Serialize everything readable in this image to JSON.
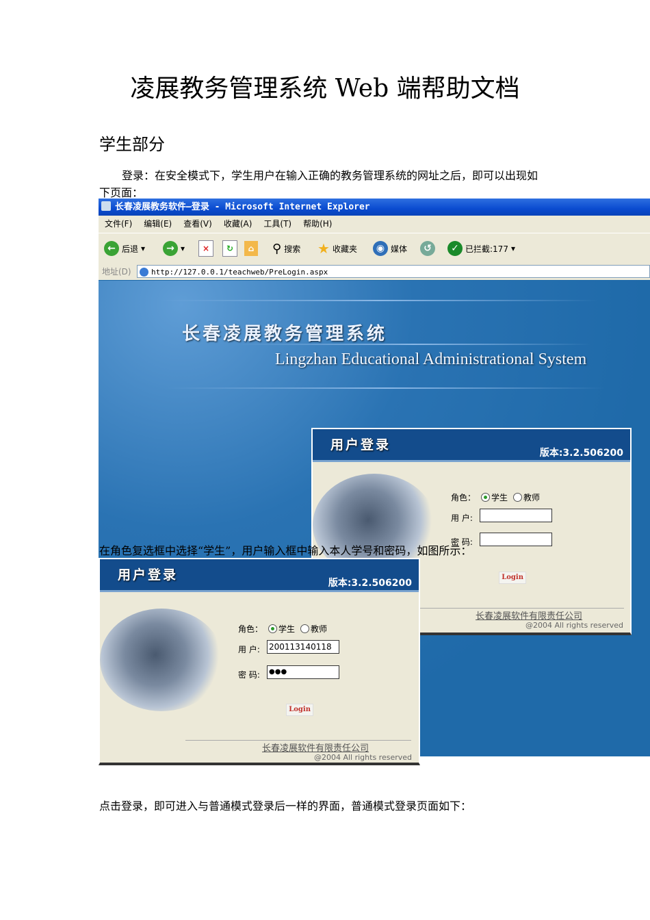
{
  "doc_title": "凌展教务管理系统 Web 端帮助文档",
  "section": "学生部分",
  "intro_line1": "登录：在安全模式下，学生用户在输入正确的教务管理系统的网址之后，即可以出现如",
  "intro_line2": "下页面：",
  "browser": {
    "title": "长春凌展教务软件—登录 - Microsoft Internet Explorer",
    "menu": [
      "文件(F)",
      "编辑(E)",
      "查看(V)",
      "收藏(A)",
      "工具(T)",
      "帮助(H)"
    ],
    "toolbar": {
      "back": "后退",
      "search": "搜索",
      "favorites": "收藏夹",
      "media": "媒体",
      "blocked": "已拦截:177"
    },
    "address_label": "地址(D)",
    "url": "http://127.0.0.1/teachweb/PreLogin.aspx"
  },
  "system": {
    "name_cn": "长春凌展教务管理系统",
    "name_en": "Lingzhan Educational Administrational System"
  },
  "login_panel": {
    "title": "用户登录",
    "version": "版本:3.2.506200",
    "role_label": "角色：",
    "role_student": "学生",
    "role_teacher": "教师",
    "user_label": "用 户:",
    "pass_label": "密 码:",
    "login_button": "Login",
    "company": "长春凌展软件有限责任公司",
    "copyright": "@2004 All rights reserved"
  },
  "filled_panel": {
    "user_value": "200113140118",
    "pass_value": "●●●"
  },
  "caption": "在角色复选框中选择“学生”，用户输入框中输入本人学号和密码，如图所示：",
  "bottom_text": "点击登录，即可进入与普通模式登录后一样的界面，普通模式登录页面如下："
}
